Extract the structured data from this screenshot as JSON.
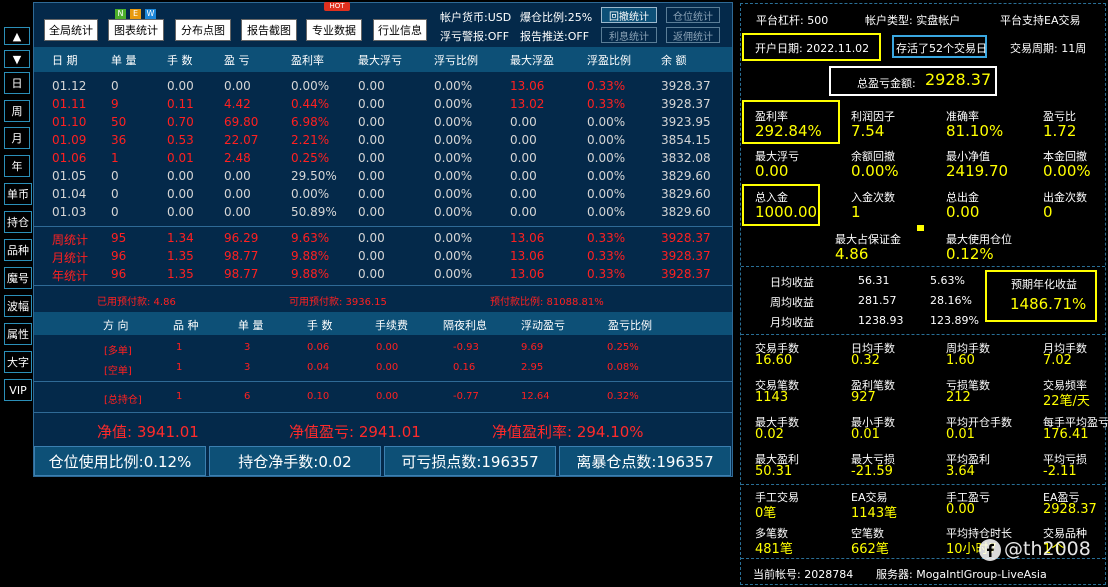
{
  "side_nav": {
    "up_arrow": "▲",
    "down_arrow": "▼",
    "items": [
      "日",
      "周",
      "月",
      "年",
      "单币",
      "持仓",
      "品种",
      "魔号",
      "波幅",
      "属性",
      "大字",
      "VIP"
    ]
  },
  "toolbar": {
    "buttons": [
      "全局统计",
      "图表统计",
      "分布点图",
      "报告截图",
      "专业数据",
      "行业信息"
    ],
    "new_badge": [
      "N",
      "E",
      "W"
    ],
    "hot_badge": "HOT",
    "account_currency": "帐户货币:USD",
    "blowout_ratio": "爆仓比例:25%",
    "floating_loss_alert": "浮亏警报:OFF",
    "report_push": "报告推送:OFF",
    "right_buttons": [
      "回撤统计",
      "仓位统计",
      "利息统计",
      "返佣统计"
    ]
  },
  "daily_table": {
    "columns": [
      "日 期",
      "单 量",
      "手 数",
      "盈 亏",
      "盈利率",
      "最大浮亏",
      "浮亏比例",
      "最大浮盈",
      "浮盈比例",
      "余 额"
    ],
    "rows": [
      {
        "date": "01.12",
        "orders": "0",
        "lots": "0.00",
        "pl": "0.00",
        "rate": "0.00%",
        "max_floating_loss": "0.00",
        "loss_ratio": "0.00%",
        "max_floating_profit": "13.06",
        "profit_ratio": "0.33%",
        "balance": "3928.37",
        "color": "w"
      },
      {
        "date": "01.11",
        "orders": "9",
        "lots": "0.11",
        "pl": "4.42",
        "rate": "0.44%",
        "max_floating_loss": "0.00",
        "loss_ratio": "0.00%",
        "max_floating_profit": "13.02",
        "profit_ratio": "0.33%",
        "balance": "3928.37",
        "color": "r"
      },
      {
        "date": "01.10",
        "orders": "50",
        "lots": "0.70",
        "pl": "69.80",
        "rate": "6.98%",
        "max_floating_loss": "0.00",
        "loss_ratio": "0.00%",
        "max_floating_profit": "0.00",
        "profit_ratio": "0.00%",
        "balance": "3923.95",
        "color": "r"
      },
      {
        "date": "01.09",
        "orders": "36",
        "lots": "0.53",
        "pl": "22.07",
        "rate": "2.21%",
        "max_floating_loss": "0.00",
        "loss_ratio": "0.00%",
        "max_floating_profit": "0.00",
        "profit_ratio": "0.00%",
        "balance": "3854.15",
        "color": "r"
      },
      {
        "date": "01.06",
        "orders": "1",
        "lots": "0.01",
        "pl": "2.48",
        "rate": "0.25%",
        "max_floating_loss": "0.00",
        "loss_ratio": "0.00%",
        "max_floating_profit": "0.00",
        "profit_ratio": "0.00%",
        "balance": "3832.08",
        "color": "r"
      },
      {
        "date": "01.05",
        "orders": "0",
        "lots": "0.00",
        "pl": "0.00",
        "rate": "29.50%",
        "max_floating_loss": "0.00",
        "loss_ratio": "0.00%",
        "max_floating_profit": "0.00",
        "profit_ratio": "0.00%",
        "balance": "3829.60",
        "color": "w"
      },
      {
        "date": "01.04",
        "orders": "0",
        "lots": "0.00",
        "pl": "0.00",
        "rate": "0.00%",
        "max_floating_loss": "0.00",
        "loss_ratio": "0.00%",
        "max_floating_profit": "0.00",
        "profit_ratio": "0.00%",
        "balance": "3829.60",
        "color": "w"
      },
      {
        "date": "01.03",
        "orders": "0",
        "lots": "0.00",
        "pl": "0.00",
        "rate": "50.89%",
        "max_floating_loss": "0.00",
        "loss_ratio": "0.00%",
        "max_floating_profit": "0.00",
        "profit_ratio": "0.00%",
        "balance": "3829.60",
        "color": "w"
      }
    ],
    "summary_rows": [
      {
        "date": "周统计",
        "orders": "95",
        "lots": "1.34",
        "pl": "96.29",
        "rate": "9.63%",
        "max_floating_loss": "0.00",
        "loss_ratio": "0.00%",
        "max_floating_profit": "13.06",
        "profit_ratio": "0.33%",
        "balance": "3928.37"
      },
      {
        "date": "月统计",
        "orders": "96",
        "lots": "1.35",
        "pl": "98.77",
        "rate": "9.88%",
        "max_floating_loss": "0.00",
        "loss_ratio": "0.00%",
        "max_floating_profit": "13.06",
        "profit_ratio": "0.33%",
        "balance": "3928.37"
      },
      {
        "date": "年统计",
        "orders": "96",
        "lots": "1.35",
        "pl": "98.77",
        "rate": "9.88%",
        "max_floating_loss": "0.00",
        "loss_ratio": "0.00%",
        "max_floating_profit": "13.06",
        "profit_ratio": "0.33%",
        "balance": "3928.37"
      }
    ]
  },
  "margin_line": {
    "used_margin": "已用预付款: 4.86",
    "free_margin": "可用预付款: 3936.15",
    "margin_ratio": "预付款比例: 81088.81%"
  },
  "positions_table": {
    "columns": [
      "方 向",
      "品 种",
      "单 量",
      "手 数",
      "手续费",
      "隔夜利息",
      "浮动盈亏",
      "盈亏比例"
    ],
    "rows": [
      {
        "direction": "[多单]",
        "symbol": "1",
        "orders": "3",
        "lots": "0.06",
        "commission": "0.00",
        "swap": "-0.93",
        "floating": "9.69",
        "ratio": "0.25%"
      },
      {
        "direction": "[空单]",
        "symbol": "1",
        "orders": "3",
        "lots": "0.04",
        "commission": "0.00",
        "swap": "0.16",
        "floating": "2.95",
        "ratio": "0.08%"
      }
    ],
    "total_row": {
      "direction": "[总持仓]",
      "symbol": "1",
      "orders": "6",
      "lots": "0.10",
      "commission": "0.00",
      "swap": "-0.77",
      "floating": "12.64",
      "ratio": "0.32%"
    }
  },
  "equity_line": {
    "net_value": "净值: 3941.01",
    "net_pl": "净值盈亏: 2941.01",
    "net_rate": "净值盈利率: 294.10%"
  },
  "bottom_bar": [
    "仓位使用比例:0.12%",
    "持仓净手数:0.02",
    "可亏损点数:196357",
    "离暴仓点数:196357"
  ],
  "right_panel": {
    "platform_leverage": "平台杠杆: 500",
    "account_type": "帐户类型: 实盘帐户",
    "ea_support": "平台支持EA交易",
    "open_date": "开户日期: 2022.11.02",
    "alive_days": "存活了52个交易日",
    "trade_period": "交易周期: 11周",
    "total_pl_label": "总盈亏金额:",
    "total_pl_value": "2928.37",
    "grid1": [
      {
        "label": "盈利率",
        "value": "292.84%"
      },
      {
        "label": "利润因子",
        "value": "7.54"
      },
      {
        "label": "准确率",
        "value": "81.10%"
      },
      {
        "label": "盈亏比",
        "value": "1.72"
      },
      {
        "label": "最大浮亏",
        "value": "0.00"
      },
      {
        "label": "余额回撤",
        "value": "0.00%"
      },
      {
        "label": "最小净值",
        "value": "2419.70"
      },
      {
        "label": "本金回撤",
        "value": "0.00%"
      },
      {
        "label": "总入金",
        "value": "1000.00"
      },
      {
        "label": "入金次数",
        "value": "1"
      },
      {
        "label": "总出金",
        "value": "0.00"
      },
      {
        "label": "出金次数",
        "value": "0"
      }
    ],
    "max_margin_label": "最大占保证金",
    "max_margin_value": "4.86",
    "max_position_label": "最大使用仓位",
    "max_position_value": "0.12%",
    "income": [
      {
        "label": "日均收益",
        "value": "56.31",
        "pct": "5.63%"
      },
      {
        "label": "周均收益",
        "value": "281.57",
        "pct": "28.16%"
      },
      {
        "label": "月均收益",
        "value": "1238.93",
        "pct": "123.89%"
      }
    ],
    "expected_label": "预期年化收益",
    "expected_value": "1486.71%",
    "grid2": [
      {
        "label": "交易手数",
        "value": "16.60"
      },
      {
        "label": "日均手数",
        "value": "0.32"
      },
      {
        "label": "周均手数",
        "value": "1.60"
      },
      {
        "label": "月均手数",
        "value": "7.02"
      },
      {
        "label": "交易笔数",
        "value": "1143"
      },
      {
        "label": "盈利笔数",
        "value": "927"
      },
      {
        "label": "亏损笔数",
        "value": "212"
      },
      {
        "label": "交易频率",
        "value": "22笔/天"
      },
      {
        "label": "最大手数",
        "value": "0.02"
      },
      {
        "label": "最小手数",
        "value": "0.01"
      },
      {
        "label": "平均开仓手数",
        "value": "0.01"
      },
      {
        "label": "每手平均盈亏",
        "value": "176.41"
      },
      {
        "label": "最大盈利",
        "value": "50.31"
      },
      {
        "label": "最大亏损",
        "value": "-21.59"
      },
      {
        "label": "平均盈利",
        "value": "3.64"
      },
      {
        "label": "平均亏损",
        "value": "-2.11"
      },
      {
        "label": "手工交易",
        "value": "0笔"
      },
      {
        "label": "EA交易",
        "value": "1143笔"
      },
      {
        "label": "手工盈亏",
        "value": "0.00"
      },
      {
        "label": "EA盈亏",
        "value": "2928.37"
      },
      {
        "label": "多笔数",
        "value": "481笔"
      },
      {
        "label": "空笔数",
        "value": "662笔"
      },
      {
        "label": "平均持仓时长",
        "value": "10小时7"
      },
      {
        "label": "交易品种",
        "value": "1个"
      }
    ],
    "account_no": "当前帐号: 2028784",
    "server": "服务器: MogaIntlGroup-LiveAsia",
    "watermark": "@th2008"
  }
}
